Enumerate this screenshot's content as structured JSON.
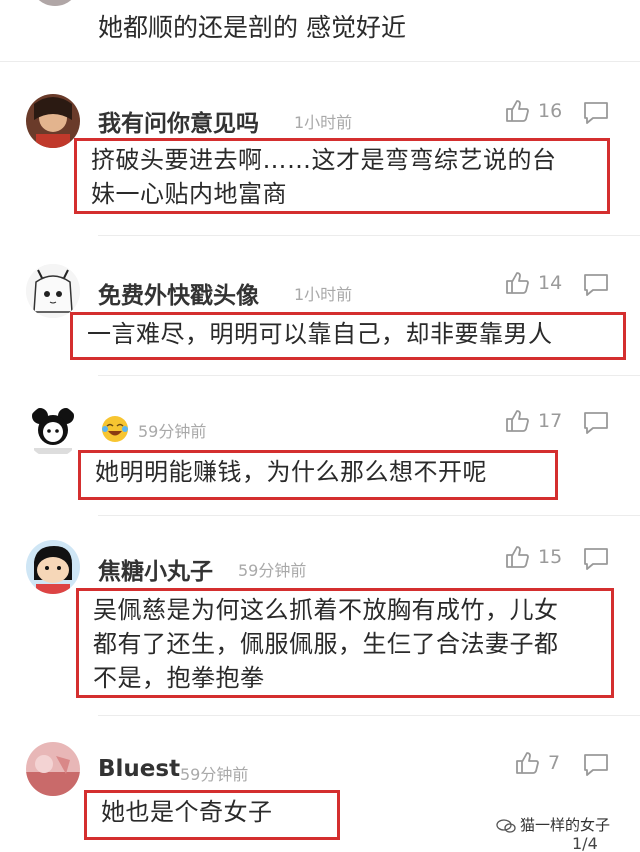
{
  "top_comment": {
    "text": "她都顺的还是剖的 感觉好近"
  },
  "comments": [
    {
      "username": "我有问你意见吗",
      "time": "1小时前",
      "likes": "16",
      "lines": [
        "挤破头要进去啊……这才是弯弯综艺说的台",
        "妹一心贴内地富商"
      ]
    },
    {
      "username": "免费外快戳头像",
      "time": "1小时前",
      "likes": "14",
      "lines": [
        "一言难尽，明明可以靠自己，却非要靠男人"
      ]
    },
    {
      "username": "",
      "time": "59分钟前",
      "likes": "17",
      "lines": [
        "她明明能赚钱，为什么那么想不开呢"
      ]
    },
    {
      "username": "焦糖小丸子",
      "time": "59分钟前",
      "likes": "15",
      "lines": [
        "吴佩慈是为何这么抓着不放胸有成竹，儿女",
        "都有了还生，佩服佩服，生仨了合法妻子都",
        "不是，抱拳抱拳"
      ]
    },
    {
      "username": "Bluest",
      "time": "59分钟前",
      "likes": "7",
      "lines": [
        "她也是个奇女子"
      ]
    }
  ],
  "watermark": {
    "text": "猫一样的女子"
  },
  "page_indicator": "1/4",
  "colors": {
    "highlight_border": "#d42f2f",
    "meta_text": "#a9a9a9"
  }
}
